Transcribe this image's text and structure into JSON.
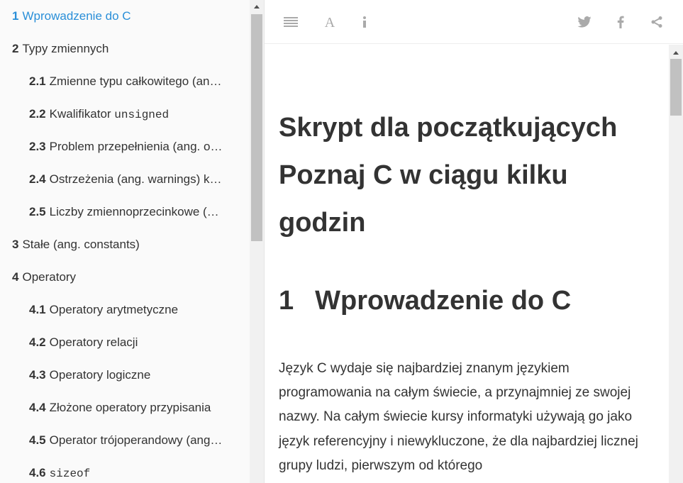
{
  "sidebar": {
    "items": [
      {
        "num": "1",
        "label": "Wprowadzenie do C",
        "code": ""
      },
      {
        "num": "2",
        "label": "Typy zmiennych",
        "code": ""
      },
      {
        "num": "2.1",
        "label": "Zmienne typu całkowitego (an…",
        "code": ""
      },
      {
        "num": "2.2",
        "label": "Kwalifikator ",
        "code": "unsigned"
      },
      {
        "num": "2.3",
        "label": "Problem przepełnienia (ang. o…",
        "code": ""
      },
      {
        "num": "2.4",
        "label": "Ostrzeżenia (ang. warnings) k…",
        "code": ""
      },
      {
        "num": "2.5",
        "label": "Liczby zmiennoprzecinkowe (…",
        "code": ""
      },
      {
        "num": "3",
        "label": "Stałe (ang. constants)",
        "code": ""
      },
      {
        "num": "4",
        "label": "Operatory",
        "code": ""
      },
      {
        "num": "4.1",
        "label": "Operatory arytmetyczne",
        "code": ""
      },
      {
        "num": "4.2",
        "label": "Operatory relacji",
        "code": ""
      },
      {
        "num": "4.3",
        "label": "Operatory logiczne",
        "code": ""
      },
      {
        "num": "4.4",
        "label": "Złożone operatory przypisania",
        "code": ""
      },
      {
        "num": "4.5",
        "label": "Operator trójoperandowy (ang…",
        "code": ""
      },
      {
        "num": "4.6",
        "label": "",
        "code": "sizeof"
      }
    ]
  },
  "toolbar": {
    "left_icons": [
      "list-icon",
      "font-icon",
      "info-icon"
    ],
    "right_icons": [
      "twitter-icon",
      "facebook-icon",
      "share-icon"
    ]
  },
  "content": {
    "book_title": "Skrypt dla początkujących Poznaj C w ciągu kilku godzin",
    "chapter_number": "1",
    "chapter_title": "Wprowadzenie do C",
    "paragraph": "Język C wydaje się najbardziej znanym językiem programowania na całym świecie, a przynajmniej ze swojej nazwy. Na całym świecie kursy informatyki używają go jako język referencyjny i niewykluczone, że dla najbardziej licznej grupy ludzi, pierwszym od którego"
  },
  "colors": {
    "active_link": "#2a8fd8",
    "text": "#333333",
    "icon": "#aaaaaa"
  }
}
